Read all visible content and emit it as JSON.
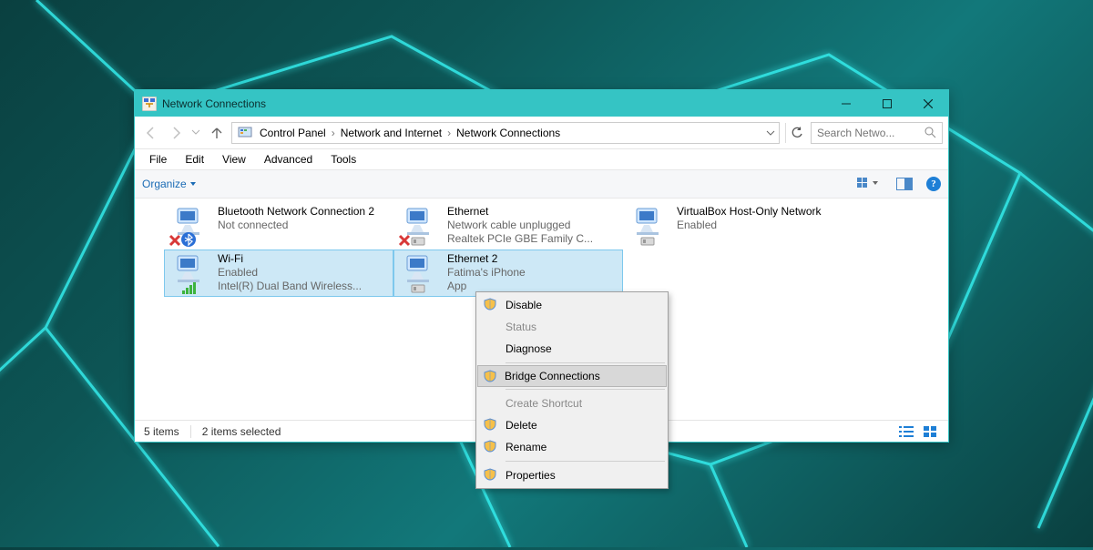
{
  "window": {
    "title": "Network Connections"
  },
  "breadcrumb": {
    "root": "Control Panel",
    "mid": "Network and Internet",
    "leaf": "Network Connections"
  },
  "search": {
    "placeholder": "Search Netwo..."
  },
  "menubar": {
    "file": "File",
    "edit": "Edit",
    "view": "View",
    "advanced": "Advanced",
    "tools": "Tools"
  },
  "toolbar": {
    "organize": "Organize"
  },
  "connections": {
    "bluetooth": {
      "name": "Bluetooth Network Connection 2",
      "status": "Not connected"
    },
    "ethernet": {
      "name": "Ethernet",
      "status": "Network cable unplugged",
      "desc": "Realtek PCIe GBE Family C..."
    },
    "vbox": {
      "name": "VirtualBox Host-Only Network",
      "status": "Enabled"
    },
    "wifi": {
      "name": "Wi-Fi",
      "status": "Enabled",
      "desc": "Intel(R) Dual Band Wireless..."
    },
    "ethernet2": {
      "name": "Ethernet 2",
      "status": "Fatima's iPhone",
      "desc": "App"
    }
  },
  "context_menu": {
    "disable": "Disable",
    "status": "Status",
    "diagnose": "Diagnose",
    "bridge": "Bridge Connections",
    "shortcut": "Create Shortcut",
    "delete": "Delete",
    "rename": "Rename",
    "properties": "Properties"
  },
  "statusbar": {
    "items": "5 items",
    "selected": "2 items selected"
  },
  "help_glyph": "?"
}
